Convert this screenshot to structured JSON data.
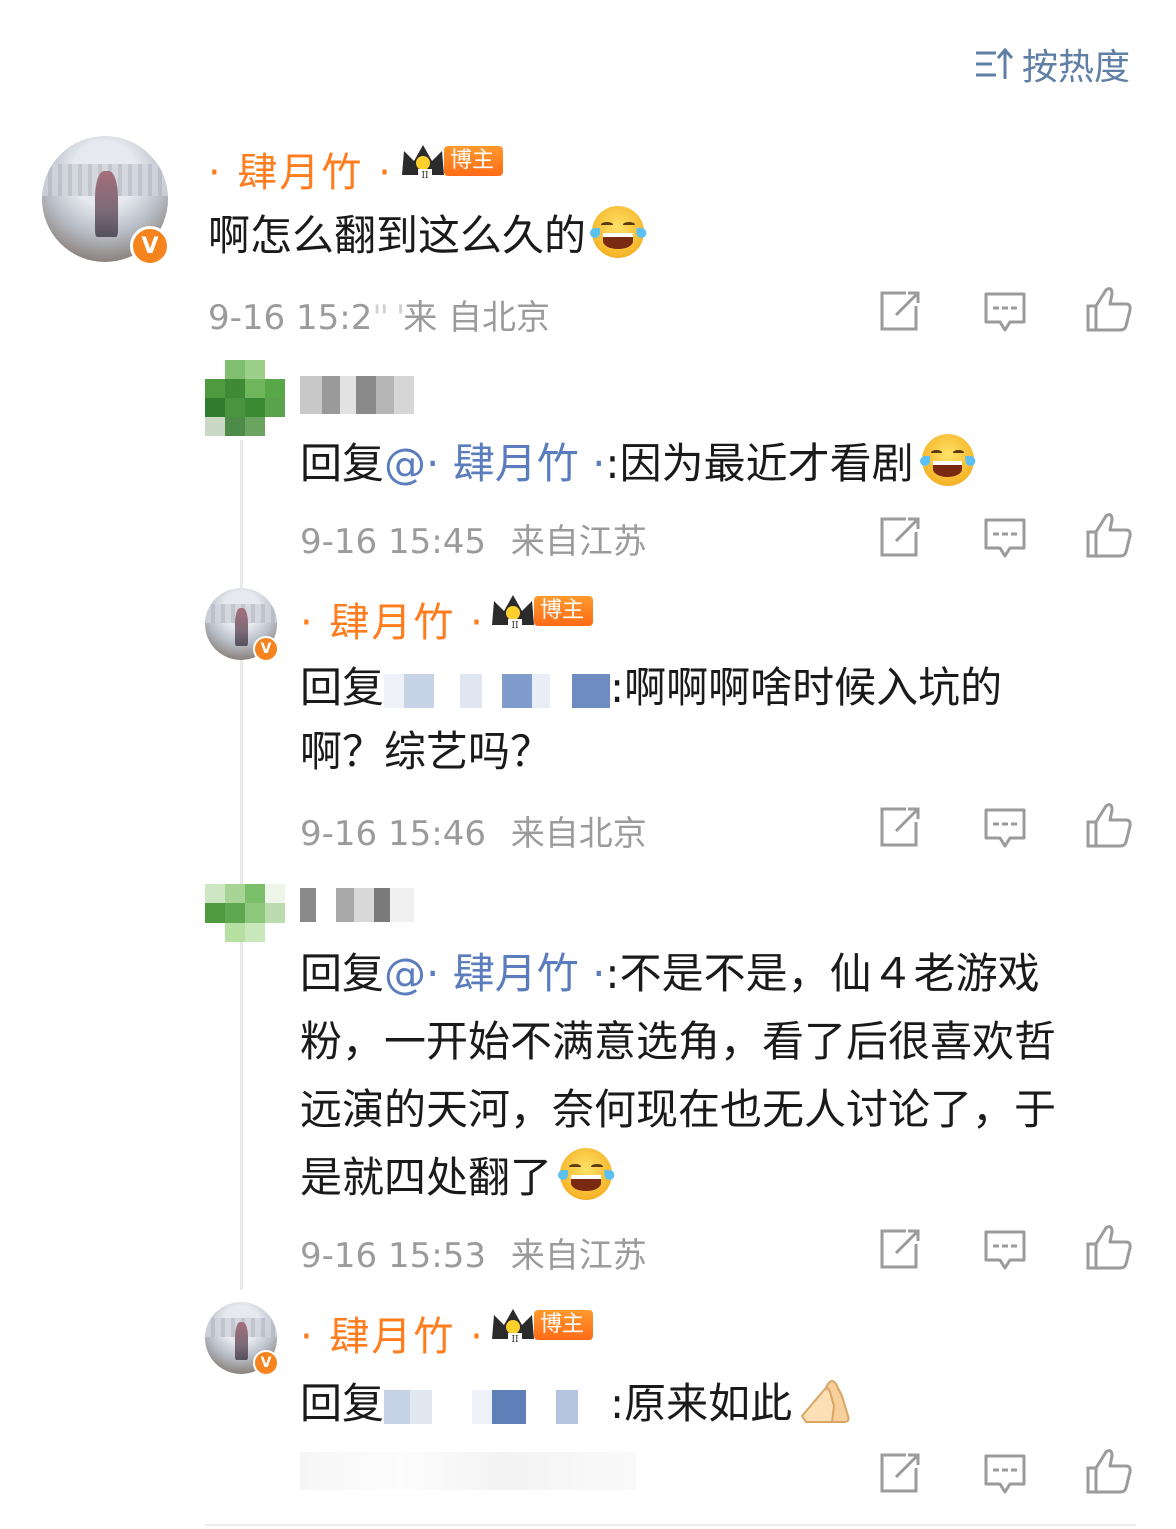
{
  "sort": {
    "icon": "sort-icon",
    "label": "按热度"
  },
  "colors": {
    "username": "#ff7c1f",
    "mention": "#5b7dbd",
    "meta": "#9b9b9b",
    "badge": "#ff7c1f",
    "sort": "#5f7fa6"
  },
  "comments": [
    {
      "user": "· 肆月竹 ·",
      "badge": "博主",
      "verified": true,
      "text": "啊怎么翻到这么久的",
      "emoji": "laughing-crying-emoji",
      "time": "9-16 15:2",
      "time_obscured": "来 自北京"
    }
  ],
  "replies": [
    {
      "reply_prefix": "回复",
      "mention": "@· 肆月竹 ·",
      "text": ":因为最近才看剧",
      "emoji": "laughing-crying-emoji",
      "time": "9-16 15:45",
      "location": "来自江苏"
    },
    {
      "user": "· 肆月竹 ·",
      "badge": "博主",
      "verified": true,
      "reply_prefix": "回复",
      "text_line1": ":啊啊啊啥时候入坑的",
      "text_line2": "啊？综艺吗？",
      "time": "9-16 15:46",
      "location": "来自北京"
    },
    {
      "reply_prefix": "回复",
      "mention": "@· 肆月竹 ·",
      "text_line1": ":不是不是，仙４老游戏",
      "text_line2": "粉，一开始不满意选角，看了后很喜欢哲",
      "text_line3": "远演的天河，奈何现在也无人讨论了，于",
      "text_line4": "是就四处翻了",
      "emoji": "laughing-crying-emoji",
      "time": "9-16 15:53",
      "location": "来自江苏"
    },
    {
      "user": "· 肆月竹 ·",
      "badge": "博主",
      "verified": true,
      "reply_prefix": "回复",
      "text": ":原来如此",
      "emoji": "pressed-hands-emoji"
    }
  ],
  "actions": {
    "share": "share-icon",
    "comment": "comment-icon",
    "like": "thumbs-up-icon"
  }
}
